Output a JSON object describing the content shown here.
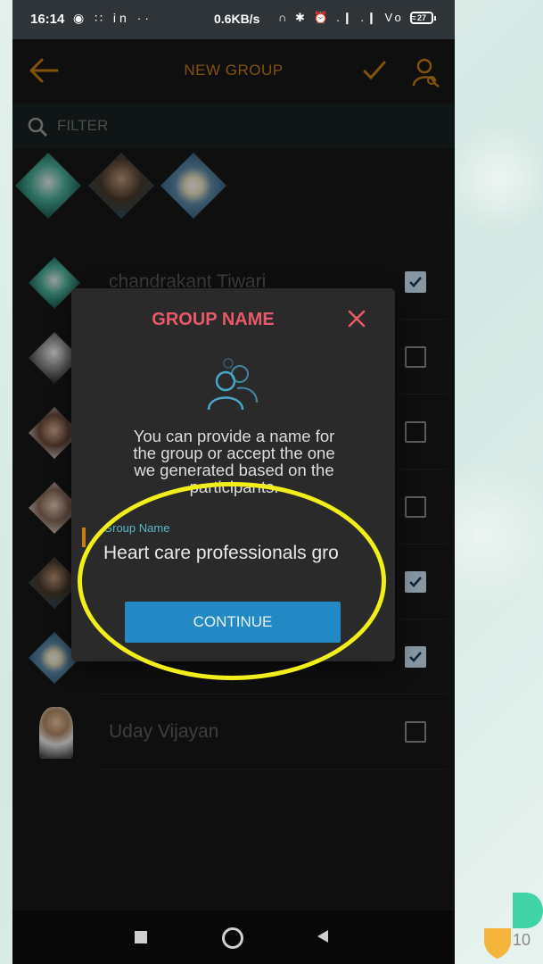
{
  "status_bar": {
    "time": "16:14",
    "left_icons": "◉ ∷ in ··",
    "speed": "0.6KB/s",
    "right_icons": "∩ ✱ ⏰ .❙ .❙ Vo ≈",
    "battery": "27"
  },
  "app_bar": {
    "title": "NEW GROUP"
  },
  "filter": {
    "placeholder": "FILTER"
  },
  "contacts": [
    {
      "name": "chandrakant Tiwari",
      "checked": true
    },
    {
      "name": "",
      "checked": false
    },
    {
      "name": "",
      "checked": false
    },
    {
      "name": "",
      "checked": false
    },
    {
      "name": "",
      "checked": true
    },
    {
      "name": "",
      "checked": true
    },
    {
      "name": "Uday Vijayan",
      "checked": false
    }
  ],
  "dialog": {
    "title": "GROUP NAME",
    "message_lines": [
      "You can provide a name for",
      "the group or accept the one",
      "we generated based on the",
      "participants."
    ],
    "field_label": "Group Name",
    "field_value": "Heart care professionals gro",
    "continue_label": "CONTINUE"
  },
  "page_number": "10",
  "colors": {
    "accent_orange": "#c97e12",
    "title_red": "#e8596a",
    "button_blue": "#2389c4",
    "label_teal": "#59b6c9",
    "highlight_yellow": "#f1ee1a"
  }
}
